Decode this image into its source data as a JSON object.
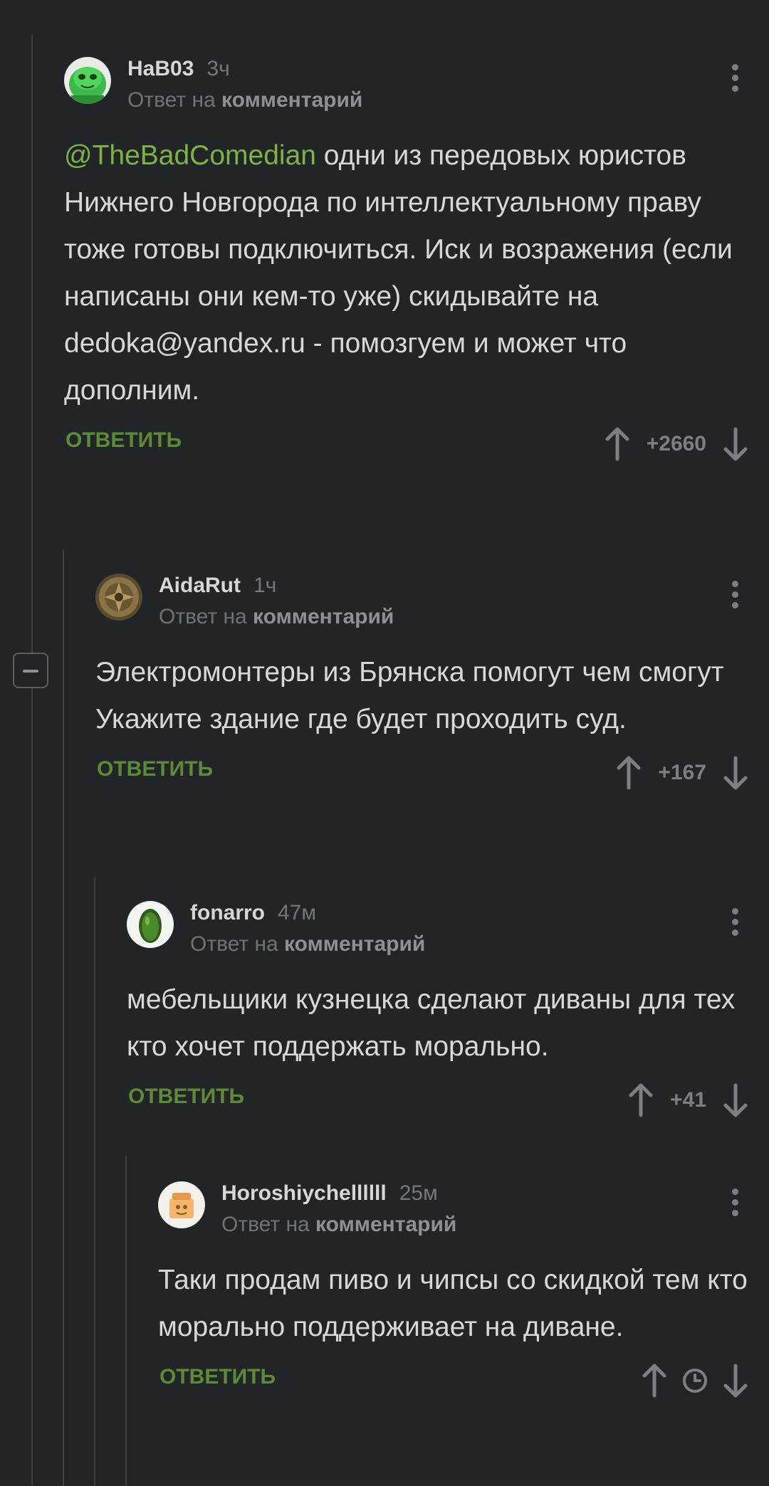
{
  "comments": [
    {
      "user": "HaB03",
      "time": "3ч",
      "reply_prefix": "Ответ на",
      "reply_target": "комментарий",
      "mention": "@TheBadComedian",
      "text": " одни из передовых юристов Нижнего Новгорода по интеллектуальному праву тоже готовы подключиться. Иск и возражения (если написаны они кем-то уже) скидывайте на dedoka@yandex.ru - помозгуем и может что дополним.",
      "reply_label": "ОТВЕТИТЬ",
      "score": "+2660"
    },
    {
      "user": "AidaRut",
      "time": "1ч",
      "reply_prefix": "Ответ на",
      "reply_target": "комментарий",
      "text": "Электромонтеры из Брянска помогут чем смогут Укажите здание где будет проходить суд.",
      "reply_label": "ОТВЕТИТЬ",
      "score": "+167"
    },
    {
      "user": "fonarro",
      "time": "47м",
      "reply_prefix": "Ответ на",
      "reply_target": "комментарий",
      "text": "мебельщики кузнецка сделают диваны для тех кто хочет поддержать морально.",
      "reply_label": "ОТВЕТИТЬ",
      "score": "+41"
    },
    {
      "user": "Horoshiychellllll",
      "time": "25м",
      "reply_prefix": "Ответ на",
      "reply_target": "комментарий",
      "text": "Таки продам пиво и чипсы со скидкой тем кто морально поддерживает на диване.",
      "reply_label": "ОТВЕТИТЬ"
    }
  ],
  "colors": {
    "background": "#222527",
    "accent_green": "#5d8b35",
    "mention_green": "#7cb342"
  }
}
